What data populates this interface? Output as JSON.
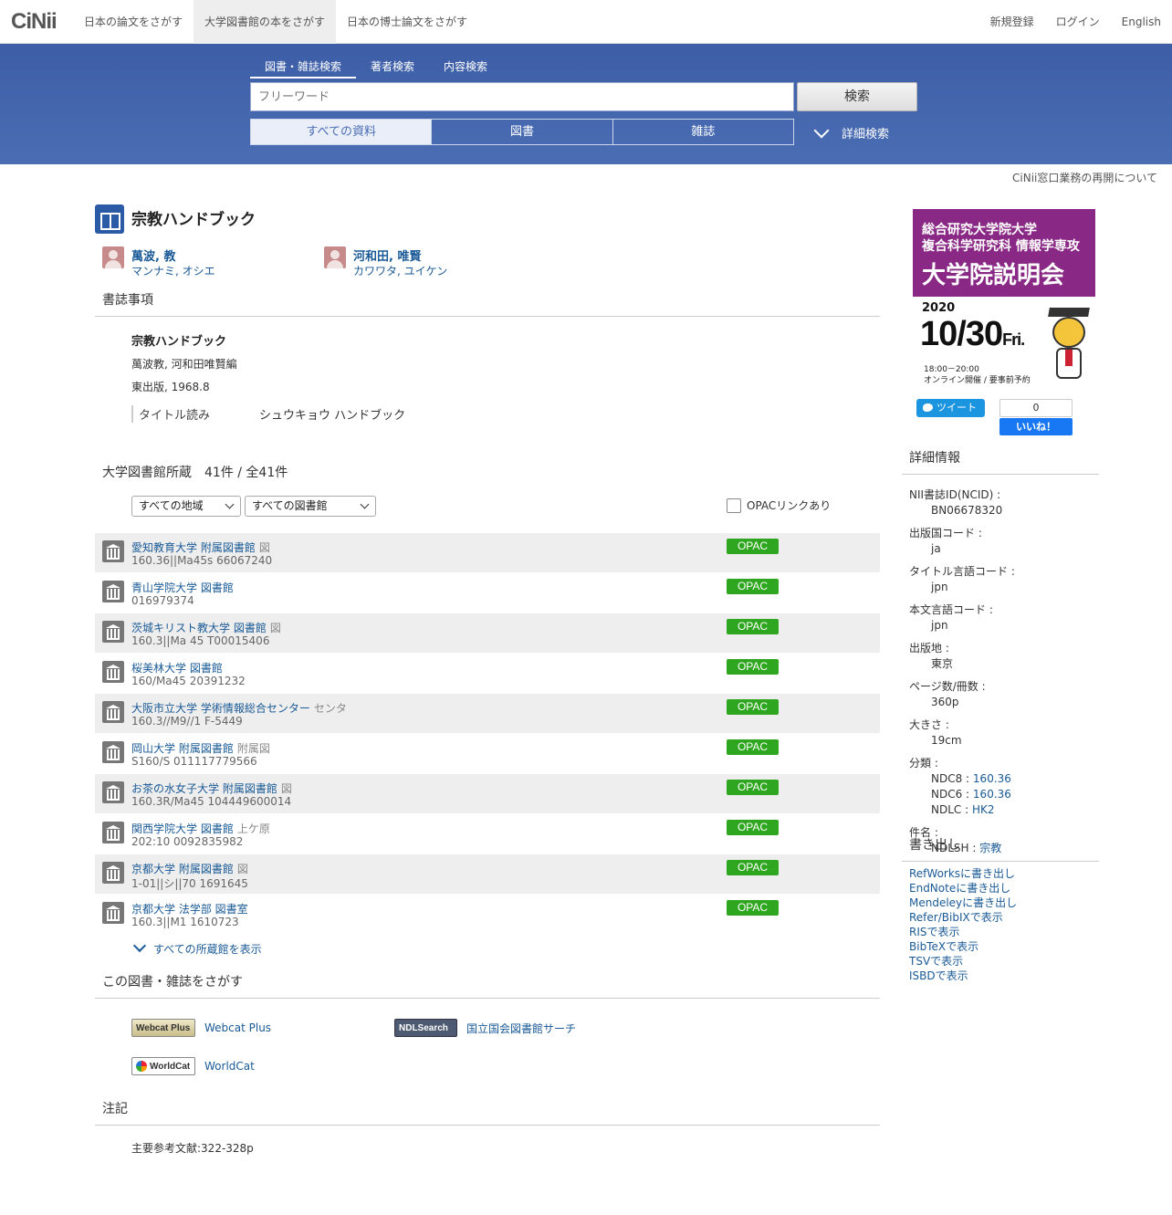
{
  "header": {
    "logo": "CiNii",
    "nav": [
      "日本の論文をさがす",
      "大学図書館の本をさがす",
      "日本の博士論文をさがす"
    ],
    "right_nav": [
      "新規登録",
      "ログイン",
      "English"
    ]
  },
  "search": {
    "tabs": [
      "図書・雑誌検索",
      "著者検索",
      "内容検索"
    ],
    "placeholder": "フリーワード",
    "button": "検索",
    "filters": [
      "すべての資料",
      "図書",
      "雑誌"
    ],
    "advanced": "詳細検索"
  },
  "notice": "CiNii窓口業務の再開について",
  "book": {
    "title": "宗教ハンドブック",
    "authors": [
      {
        "name": "萬波, 教",
        "kana": "マンナミ, オシエ"
      },
      {
        "name": "河和田, 唯賢",
        "kana": "カワワタ, ユイケン"
      }
    ]
  },
  "biblio": {
    "heading": "書誌事項",
    "title": "宗教ハンドブック",
    "responsibility": "萬波教, 河和田唯賢編",
    "publication": "東出版, 1968.8",
    "yomi_label": "タイトル読み",
    "yomi_value": "シュウキョウ ハンドブック"
  },
  "holdings": {
    "heading": "大学図書館所蔵　41件 / 全41件",
    "region_select": "すべての地域",
    "library_select": "すべての図書館",
    "opac_checkbox": "OPACリンクあり",
    "opac_label": "OPAC",
    "show_all": "すべての所蔵館を表示",
    "rows": [
      {
        "name": "愛知教育大学 附属図書館",
        "loc": "図",
        "call": "160.36||Ma45s  66067240"
      },
      {
        "name": "青山学院大学 図書館",
        "loc": "",
        "call": "016979374"
      },
      {
        "name": "茨城キリスト教大学 図書館",
        "loc": "図",
        "call": "160.3||Ma 45  T00015406"
      },
      {
        "name": "桜美林大学 図書館",
        "loc": "",
        "call": "160/Ma45  20391232"
      },
      {
        "name": "大阪市立大学 学術情報総合センター",
        "loc": "センタ",
        "call": "160.3//M9//1  F-5449"
      },
      {
        "name": "岡山大学 附属図書館",
        "loc": "附属図",
        "call": "S160/S  011117779566"
      },
      {
        "name": "お茶の水女子大学 附属図書館",
        "loc": "図",
        "call": "160.3R/Ma45  104449600014"
      },
      {
        "name": "関西学院大学 図書館",
        "loc": "上ケ原",
        "call": "202:10  0092835982"
      },
      {
        "name": "京都大学 附属図書館",
        "loc": "図",
        "call": "1-01||シ||70  1691645"
      },
      {
        "name": "京都大学 法学部 図書室",
        "loc": "",
        "call": "160.3||M1  1610723"
      }
    ]
  },
  "find": {
    "heading": "この図書・雑誌をさがす",
    "links": [
      {
        "badge": "Webcat Plus",
        "label": "Webcat Plus"
      },
      {
        "badge": "NDLSearch",
        "label": "国立国会図書館サーチ"
      },
      {
        "badge": "WorldCat",
        "label": "WorldCat"
      }
    ]
  },
  "notes": {
    "heading": "注記",
    "text": "主要参考文献:322-328p"
  },
  "ad": {
    "line1": "総合研究大学院大学",
    "line2": "複合科学研究科 情報学専攻",
    "line3": "大学院説明会",
    "year": "2020",
    "date": "10/30",
    "dow": "Fri.",
    "time": "18:00－20:00",
    "online": "オンライン開催 / 要事前予約",
    "accent": "#8a2886"
  },
  "social": {
    "tweet": "ツイート",
    "like_count": "0",
    "like": "いいね！"
  },
  "details": {
    "heading": "詳細情報",
    "ncid_label": "NII書誌ID(NCID) :",
    "ncid": "BN06678320",
    "country_label": "出版国コード :",
    "country": "ja",
    "title_lang_label": "タイトル言語コード :",
    "title_lang": "jpn",
    "text_lang_label": "本文言語コード :",
    "text_lang": "jpn",
    "place_label": "出版地 :",
    "place": "東京",
    "pages_label": "ページ数/冊数 :",
    "pages": "360p",
    "size_label": "大きさ :",
    "size": "19cm",
    "class_label": "分類 :",
    "ndc8_label": "NDC8 :",
    "ndc8": "160.36",
    "ndc6_label": "NDC6 :",
    "ndc6": "160.36",
    "ndlc_label": "NDLC :",
    "ndlc": "HK2",
    "subject_label": "件名 :",
    "ndlsh_label": "NDLSH :",
    "ndlsh": "宗教"
  },
  "export": {
    "heading": "書き出し",
    "items": [
      "RefWorksに書き出し",
      "EndNoteに書き出し",
      "Mendeleyに書き出し",
      "Refer/BibIXで表示",
      "RISで表示",
      "BibTeXで表示",
      "TSVで表示",
      "ISBDで表示"
    ]
  }
}
